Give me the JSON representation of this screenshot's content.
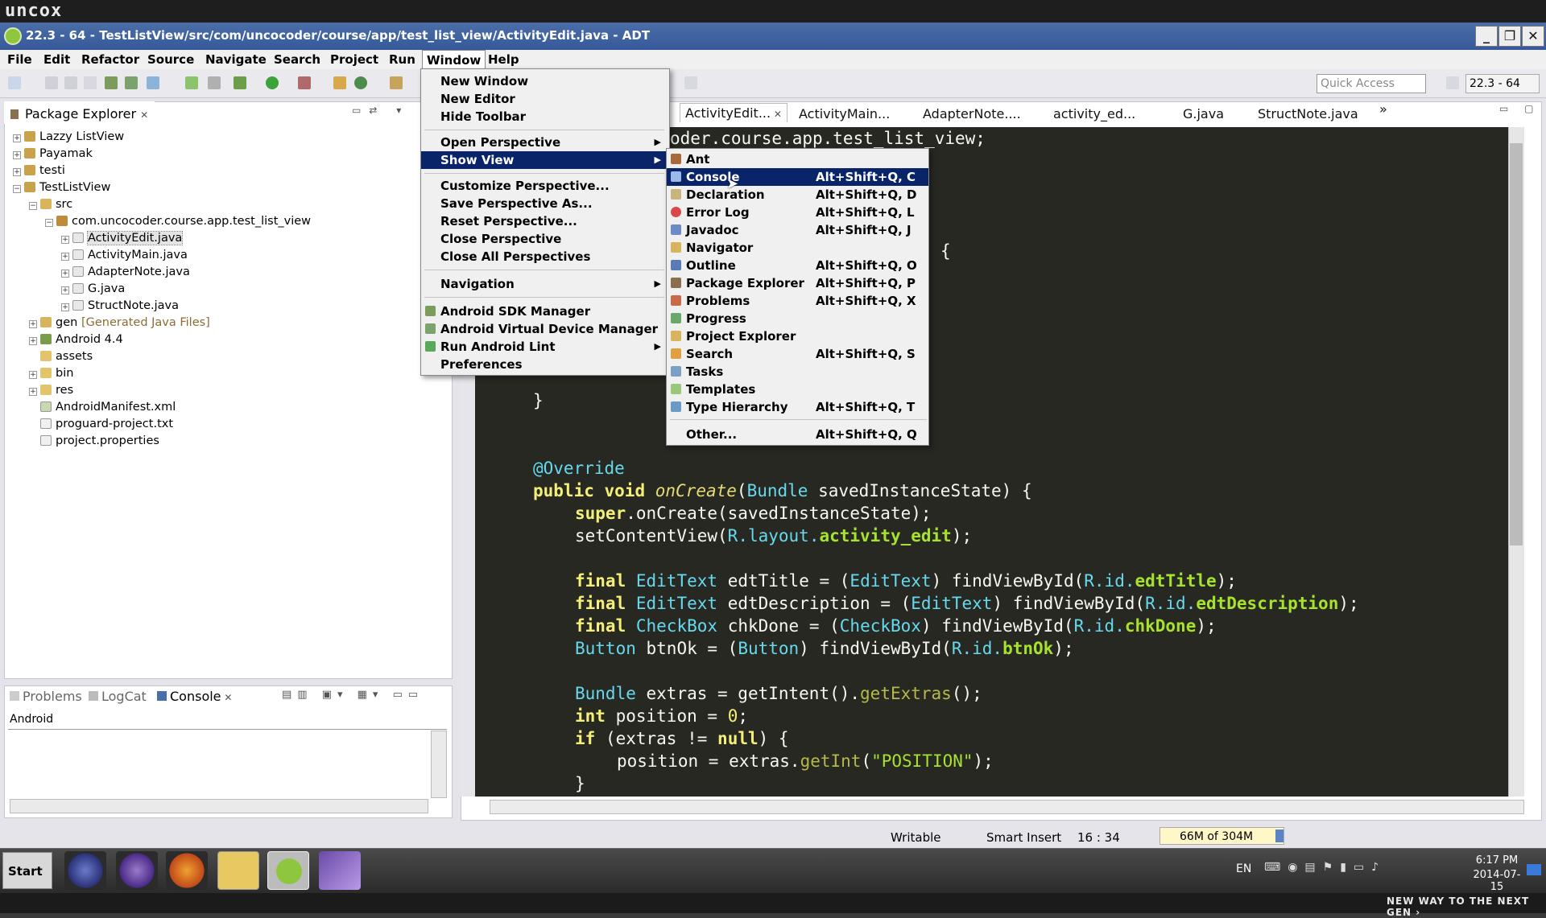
{
  "brand": "uncox",
  "window": {
    "title": "22.3 - 64 - TestListView/src/com/uncocoder/course/app/test_list_view/ActivityEdit.java - ADT",
    "minimize": "_",
    "restore": "❐",
    "close": "✕"
  },
  "menubar": [
    "File",
    "Edit",
    "Refactor",
    "Source",
    "Navigate",
    "Search",
    "Project",
    "Run",
    "Window",
    "Help"
  ],
  "toolbar": {
    "quick_access_placeholder": "Quick Access",
    "perspective": "22.3 - 64"
  },
  "package_explorer": {
    "tab": "Package Explorer",
    "items": [
      {
        "label": "Lazzy ListView"
      },
      {
        "label": "Payamak"
      },
      {
        "label": "testi"
      },
      {
        "label": "TestListView"
      },
      {
        "label": "src"
      },
      {
        "label": "com.uncocoder.course.app.test_list_view"
      },
      {
        "label": "ActivityEdit.java"
      },
      {
        "label": "ActivityMain.java"
      },
      {
        "label": "AdapterNote.java"
      },
      {
        "label": "G.java"
      },
      {
        "label": "StructNote.java"
      },
      {
        "label": "gen",
        "extra": "[Generated Java Files]"
      },
      {
        "label": "Android 4.4"
      },
      {
        "label": "assets"
      },
      {
        "label": "bin"
      },
      {
        "label": "res"
      },
      {
        "label": "AndroidManifest.xml"
      },
      {
        "label": "proguard-project.txt"
      },
      {
        "label": "project.properties"
      }
    ]
  },
  "bottom_panel": {
    "tabs": [
      "Problems",
      "LogCat",
      "Console"
    ],
    "console_label": "Android"
  },
  "editor": {
    "tabs": [
      "ActivityEdit...",
      "ActivityMain...",
      "AdapterNote....",
      "activity_ed...",
      "G.java",
      "StructNote.java"
    ],
    "overflow": "»"
  },
  "window_menu": {
    "items": [
      {
        "label": "New Window"
      },
      {
        "label": "New Editor"
      },
      {
        "label": "Hide Toolbar"
      },
      {
        "label": "Open Perspective"
      },
      {
        "label": "Show View"
      },
      {
        "label": "Customize Perspective..."
      },
      {
        "label": "Save Perspective As..."
      },
      {
        "label": "Reset Perspective..."
      },
      {
        "label": "Close Perspective"
      },
      {
        "label": "Close All Perspectives"
      },
      {
        "label": "Navigation"
      },
      {
        "label": "Android SDK Manager"
      },
      {
        "label": "Android Virtual Device Manager"
      },
      {
        "label": "Run Android Lint"
      },
      {
        "label": "Preferences"
      }
    ]
  },
  "show_view_menu": {
    "items": [
      {
        "label": "Ant",
        "shortcut": ""
      },
      {
        "label": "Console",
        "shortcut": "Alt+Shift+Q, C"
      },
      {
        "label": "Declaration",
        "shortcut": "Alt+Shift+Q, D"
      },
      {
        "label": "Error Log",
        "shortcut": "Alt+Shift+Q, L"
      },
      {
        "label": "Javadoc",
        "shortcut": "Alt+Shift+Q, J"
      },
      {
        "label": "Navigator",
        "shortcut": ""
      },
      {
        "label": "Outline",
        "shortcut": "Alt+Shift+Q, O"
      },
      {
        "label": "Package Explorer",
        "shortcut": "Alt+Shift+Q, P"
      },
      {
        "label": "Problems",
        "shortcut": "Alt+Shift+Q, X"
      },
      {
        "label": "Progress",
        "shortcut": ""
      },
      {
        "label": "Project Explorer",
        "shortcut": ""
      },
      {
        "label": "Search",
        "shortcut": "Alt+Shift+Q, S"
      },
      {
        "label": "Tasks",
        "shortcut": ""
      },
      {
        "label": "Templates",
        "shortcut": ""
      },
      {
        "label": "Type Hierarchy",
        "shortcut": "Alt+Shift+Q, T"
      },
      {
        "label": "Other...",
        "shortcut": "Alt+Shift+Q, Q"
      }
    ]
  },
  "code": {
    "line_package": "oder.course.app.test_list_view;",
    "brace_open": "{",
    "brace_close": "}",
    "annotation": "@Override",
    "l1_public": "public",
    "l1_void": "void",
    "l1_method": "onCreate",
    "l1_type": "Bundle",
    "l1_rest": "savedInstanceState) {",
    "l2_super": "super",
    "l2_rest": ".onCreate(savedInstanceState);",
    "l3_call": "setContentView(",
    "l3_r": "R",
    "l3_layout": ".layout.",
    "l3_field": "activity_edit",
    "l3_end": ");",
    "final": "final",
    "edittext": "EditText",
    "checkbox": "CheckBox",
    "button": "Button",
    "bundle": "Bundle",
    "int": "int",
    "if": "if",
    "null": "null",
    "var_title": "edtTitle",
    "var_desc": "edtDescription",
    "var_chk": "chkDone",
    "var_btn": "btnOk",
    "find": "findViewById(",
    "r_id": "R",
    "dot_id": ".id.",
    "extras_decl": "extras = getIntent().",
    "get_extras": "getExtras",
    "position_decl": "position =",
    "zero": "0",
    "if_rest": "(extras !=",
    "assign": "position = extras.",
    "get_int": "getInt",
    "position_str": "\"POSITION\""
  },
  "status": {
    "writable": "Writable",
    "insert_mode": "Smart Insert",
    "cursor": "16 : 34",
    "heap": "66M of 304M"
  },
  "taskbar": {
    "start": "Start",
    "lang": "EN",
    "time": "6:17 PM",
    "date": "2014-07-15"
  },
  "slogan": "NEW WAY TO THE NEXT GEN ›",
  "colors": {
    "menu_highlight": "#0a246a",
    "editor_bg": "#272822",
    "titlebar": "#3d62a3"
  }
}
